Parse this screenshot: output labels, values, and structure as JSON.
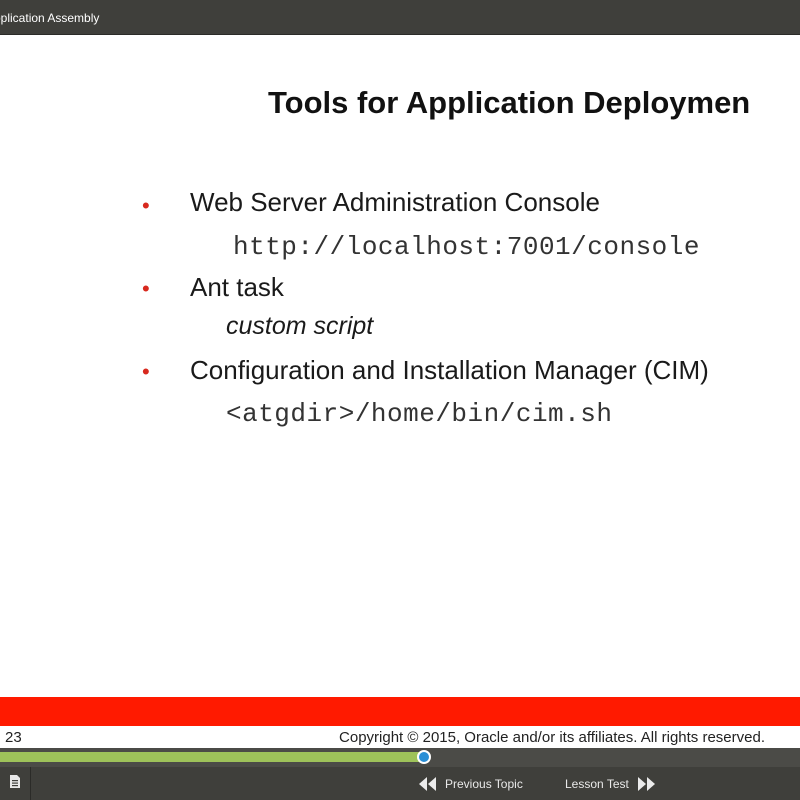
{
  "header": {
    "title": "pplication Assembly"
  },
  "slide": {
    "title": "Tools for Application Deploymen",
    "bullets": [
      {
        "text": "Web Server Administration Console",
        "sub": "http://localhost:7001/console",
        "sub_style": "mono"
      },
      {
        "text": "Ant task",
        "sub": "custom script",
        "sub_style": "italic"
      },
      {
        "text": "Configuration and Installation Manager (CIM)",
        "sub": "<atgdir>/home/bin/cim.sh",
        "sub_style": "mono"
      }
    ],
    "bullet_glyph": "•"
  },
  "footer": {
    "page_number": "23",
    "copyright": "Copyright © 2015, Oracle and/or its affiliates. All rights reserved."
  },
  "player": {
    "progress_fraction": 0.53,
    "previous_label": "Previous Topic",
    "next_label": "Lesson Test",
    "notes_icon": "document-icon"
  },
  "colors": {
    "topbar": "#3f3f3b",
    "accent_red": "#ff1a00",
    "progress_fill": "#9ec25a",
    "progress_knob": "#2a8fd6"
  }
}
